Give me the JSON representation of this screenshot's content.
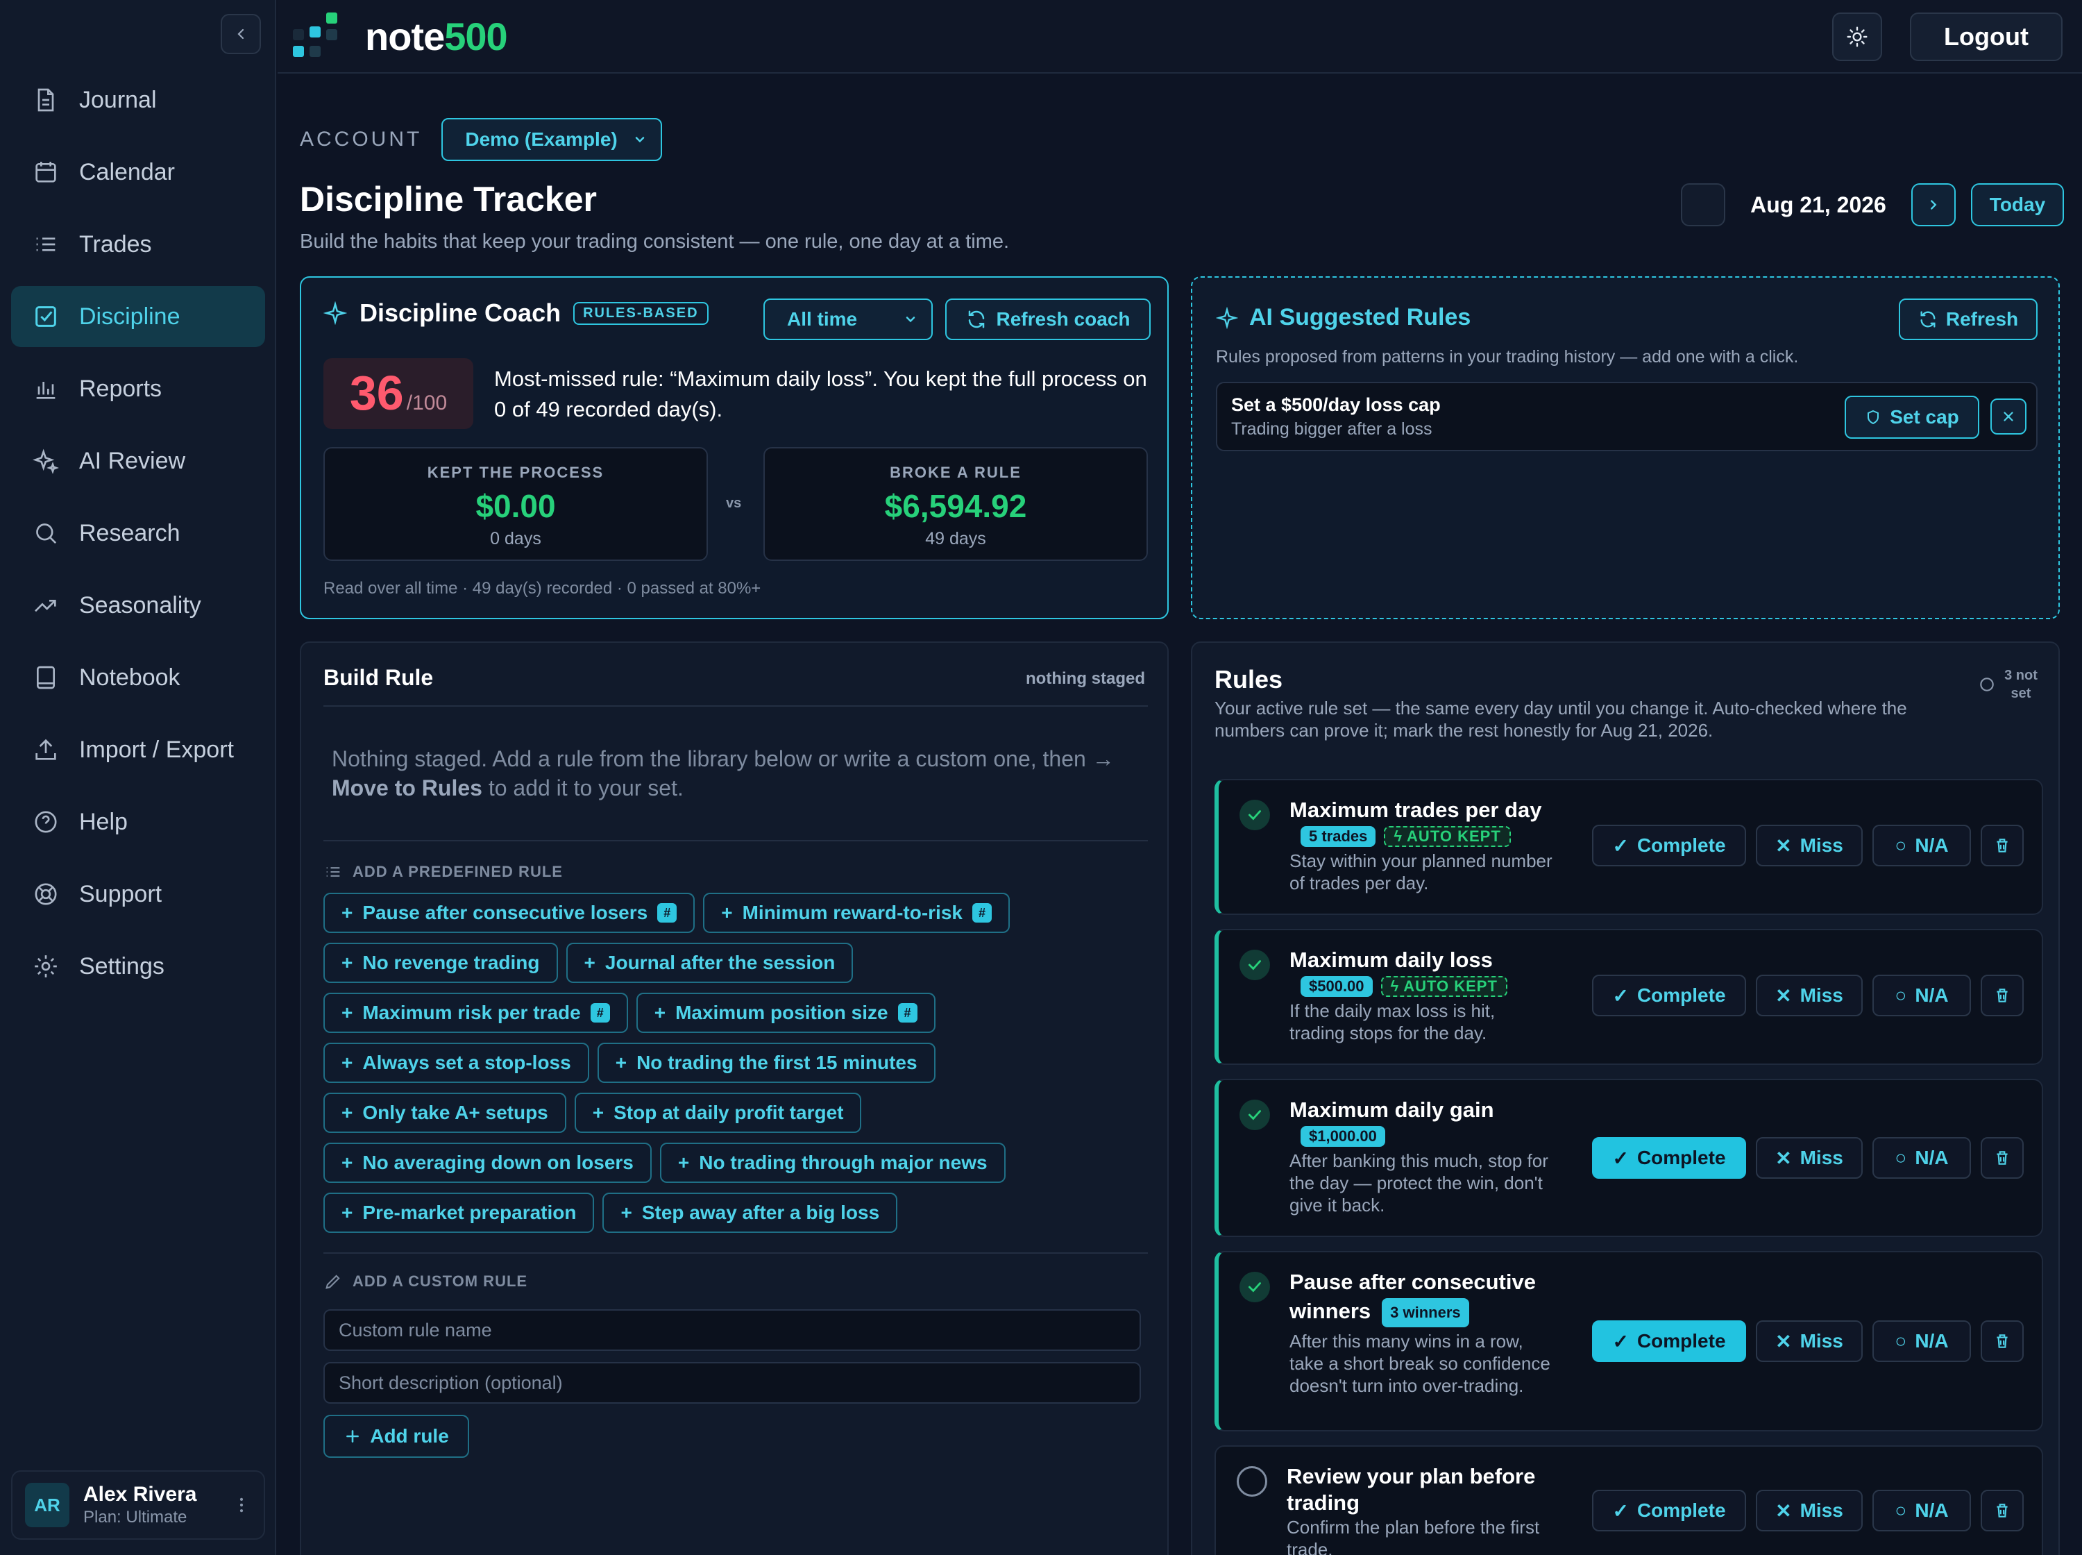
{
  "brand": {
    "name_prefix": "note",
    "name_suffix": "500"
  },
  "topbar": {
    "logout_label": "Logout"
  },
  "sidebar": {
    "items": [
      {
        "label": "Journal",
        "icon": "file-icon"
      },
      {
        "label": "Calendar",
        "icon": "calendar-icon"
      },
      {
        "label": "Trades",
        "icon": "list-icon"
      },
      {
        "label": "Discipline",
        "icon": "checkbox-icon",
        "active": true
      },
      {
        "label": "Reports",
        "icon": "bar-chart-icon"
      },
      {
        "label": "AI Review",
        "icon": "sparkle-icon"
      },
      {
        "label": "Research",
        "icon": "search-icon"
      },
      {
        "label": "Seasonality",
        "icon": "trend-icon"
      },
      {
        "label": "Notebook",
        "icon": "book-icon"
      },
      {
        "label": "Import / Export",
        "icon": "upload-icon"
      },
      {
        "label": "Help",
        "icon": "help-icon"
      },
      {
        "label": "Support",
        "icon": "lifebuoy-icon"
      },
      {
        "label": "Settings",
        "icon": "gear-icon"
      }
    ],
    "user": {
      "initials": "AR",
      "name": "Alex Rivera",
      "plan": "Plan: Ultimate"
    }
  },
  "header": {
    "account_label": "ACCOUNT",
    "account_value": "Demo (Example)",
    "title": "Discipline Tracker",
    "subtitle": "Build the habits that keep your trading consistent — one rule, one day at a time.",
    "date": "Aug 21, 2026",
    "today_label": "Today"
  },
  "coach": {
    "title": "Discipline Coach",
    "badge": "RULES-BASED",
    "range": "All time",
    "refresh_label": "Refresh coach",
    "score": "36",
    "score_max": "/100",
    "message": "Most-missed rule: “Maximum daily loss”. You kept the full process on 0 of 49 recorded day(s).",
    "kept": {
      "label": "KEPT THE PROCESS",
      "value": "$0.00",
      "days": "0 days"
    },
    "vs": "vs",
    "broke": {
      "label": "BROKE A RULE",
      "value": "$6,594.92",
      "days": "49 days"
    },
    "footer": "Read over all time · 49 day(s) recorded · 0 passed at 80%+"
  },
  "ai": {
    "title": "AI Suggested Rules",
    "refresh_label": "Refresh",
    "subtitle": "Rules proposed from patterns in your trading history — add one with a click.",
    "suggestion": {
      "title": "Set a $500/day loss cap",
      "desc": "Trading bigger after a loss",
      "action": "Set cap"
    }
  },
  "build": {
    "title": "Build Rule",
    "staged": "nothing staged",
    "empty_pre": "Nothing staged. Add a rule from the library below or write a custom one, then → ",
    "empty_bold": "Move to Rules",
    "empty_post": " to add it to your set.",
    "predefined_label": "ADD A PREDEFINED RULE",
    "chips": [
      {
        "label": "Pause after consecutive losers",
        "hash": "#"
      },
      {
        "label": "Minimum reward-to-risk",
        "hash": "#"
      },
      {
        "label": "No revenge trading"
      },
      {
        "label": "Journal after the session"
      },
      {
        "label": "Maximum risk per trade",
        "hash": "#"
      },
      {
        "label": "Maximum position size",
        "hash": "#"
      },
      {
        "label": "Always set a stop-loss"
      },
      {
        "label": "No trading the first 15 minutes"
      },
      {
        "label": "Only take A+ setups"
      },
      {
        "label": "Stop at daily profit target"
      },
      {
        "label": "No averaging down on losers"
      },
      {
        "label": "No trading through major news"
      },
      {
        "label": "Pre-market preparation"
      },
      {
        "label": "Step away after a big loss"
      }
    ],
    "custom_label": "ADD A CUSTOM RULE",
    "name_placeholder": "Custom rule name",
    "desc_placeholder": "Short description (optional)",
    "add_label": "Add rule"
  },
  "rules": {
    "title": "Rules",
    "subtitle": "Your active rule set — the same every day until you change it. Auto-checked where the numbers can prove it; mark the rest honestly for Aug 21, 2026.",
    "not_set": "3 not set",
    "actions": {
      "complete": "Complete",
      "miss": "Miss",
      "na": "N/A"
    },
    "items": [
      {
        "name": "Maximum trades per day",
        "tag": "5 trades",
        "auto": "AUTO KEPT",
        "desc": "Stay within your planned number of trades per day.",
        "state": "auto"
      },
      {
        "name": "Maximum daily loss",
        "tag": "$500.00",
        "auto": "AUTO KEPT",
        "desc": "If the daily max loss is hit, trading stops for the day.",
        "state": "auto"
      },
      {
        "name": "Maximum daily gain",
        "tag": "$1,000.00",
        "desc": "After banking this much, stop for the day — protect the win, don't give it back.",
        "state": "complete"
      },
      {
        "name": "Pause after consecutive winners",
        "tag": "3 winners",
        "desc": "After this many wins in a row, take a short break so confidence doesn't turn into over-trading.",
        "state": "complete"
      },
      {
        "name": "Review your plan before trading",
        "desc": "Confirm the plan before the first trade.",
        "state": "pending"
      }
    ]
  },
  "colors": {
    "accent": "#2ec6e0",
    "positive": "#27d17a",
    "negative": "#ff5a6e",
    "background": "#0d1424"
  }
}
